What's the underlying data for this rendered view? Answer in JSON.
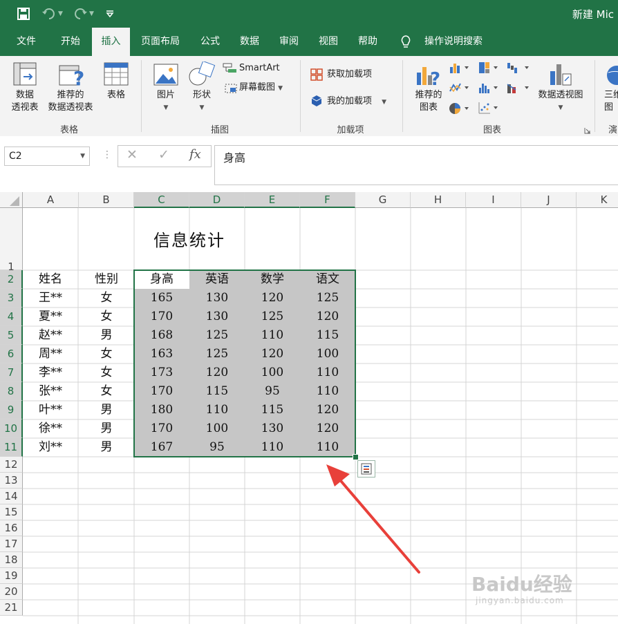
{
  "title_bar": {
    "document_title": "新建 Mic"
  },
  "menu_tabs": [
    "文件",
    "开始",
    "插入",
    "页面布局",
    "公式",
    "数据",
    "审阅",
    "视图",
    "帮助"
  ],
  "active_tab": "插入",
  "tell_me": "操作说明搜索",
  "ribbon": {
    "groups": {
      "tables": "表格",
      "illustrations": "插图",
      "addins": "加载项",
      "charts": "图表",
      "tours": "演"
    },
    "buttons": {
      "pivot_table": [
        "数据",
        "透视表"
      ],
      "recommended_pivot": [
        "推荐的",
        "数据透视表"
      ],
      "table": "表格",
      "pictures": "图片",
      "shapes": "形状",
      "smartart": "SmartArt",
      "screenshot": "屏幕截图",
      "get_addins": "获取加载项",
      "my_addins": "我的加载项",
      "recommended_charts": [
        "推荐的",
        "图表"
      ],
      "pivot_chart": "数据透视图",
      "map_3d": [
        "三维",
        "图"
      ]
    }
  },
  "name_box": "C2",
  "formula_value": "身高",
  "columns": [
    "A",
    "B",
    "C",
    "D",
    "E",
    "F",
    "G",
    "H",
    "I",
    "J",
    "K"
  ],
  "rows": [
    "1",
    "2",
    "3",
    "4",
    "5",
    "6",
    "7",
    "8",
    "9",
    "10",
    "11",
    "12",
    "13",
    "14",
    "15",
    "16",
    "17",
    "18",
    "19",
    "20",
    "21"
  ],
  "sheet": {
    "title": "信息统计",
    "headers": [
      "姓名",
      "性别",
      "身高",
      "英语",
      "数学",
      "语文"
    ],
    "data": [
      [
        "王**",
        "女",
        "165",
        "130",
        "120",
        "125"
      ],
      [
        "夏**",
        "女",
        "170",
        "130",
        "125",
        "120"
      ],
      [
        "赵**",
        "男",
        "168",
        "125",
        "110",
        "115"
      ],
      [
        "周**",
        "女",
        "163",
        "125",
        "120",
        "100"
      ],
      [
        "李**",
        "女",
        "173",
        "120",
        "100",
        "110"
      ],
      [
        "张**",
        "女",
        "170",
        "115",
        "95",
        "110"
      ],
      [
        "叶**",
        "男",
        "180",
        "110",
        "115",
        "120"
      ],
      [
        "徐**",
        "男",
        "170",
        "100",
        "130",
        "120"
      ],
      [
        "刘**",
        "男",
        "167",
        "95",
        "110",
        "110"
      ]
    ]
  },
  "watermark": {
    "brand": "Baidu经验",
    "url": "jingyan.baidu.com"
  },
  "colors": {
    "excel_green": "#217346",
    "selection_fill": "#c6c6c6",
    "arrow": "#e8403a"
  }
}
